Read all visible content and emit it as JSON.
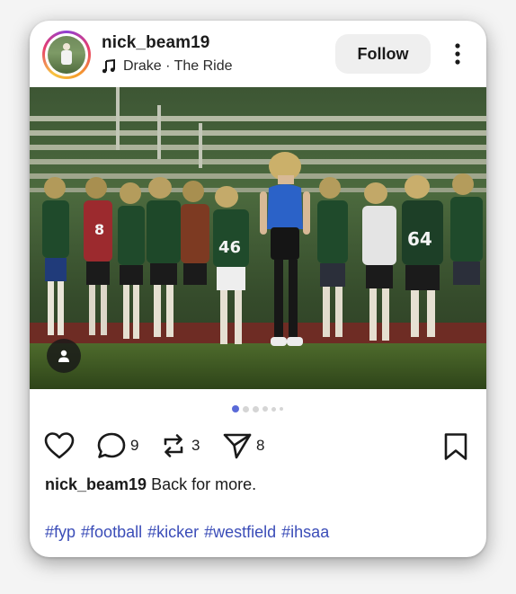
{
  "post": {
    "username": "nick_beam19",
    "music": "Drake · The Ride",
    "follow_label": "Follow",
    "media_index": 1,
    "media_count": 6,
    "caption_user": "nick_beam19",
    "caption_text": "Back for more.",
    "hashtags": [
      "#fyp",
      "#football",
      "#kicker",
      "#westfield",
      "#ihsaa"
    ]
  },
  "actions": {
    "comments": "9",
    "reposts": "3",
    "shares": "8"
  },
  "photo": {
    "jersey_numbers": [
      "8",
      "46",
      "64"
    ]
  },
  "icons": {
    "avatar": "profile-photo",
    "music": "music-note-icon",
    "more": "more-vertical-icon",
    "user_tag": "person-icon",
    "like": "heart-icon",
    "comment": "comment-bubble-icon",
    "repost": "repost-arrows-icon",
    "share": "send-icon",
    "save": "bookmark-icon"
  },
  "colors": {
    "accent": "#5a6ad8",
    "hashtag": "#3b4db8",
    "follow_bg": "#efefef"
  }
}
